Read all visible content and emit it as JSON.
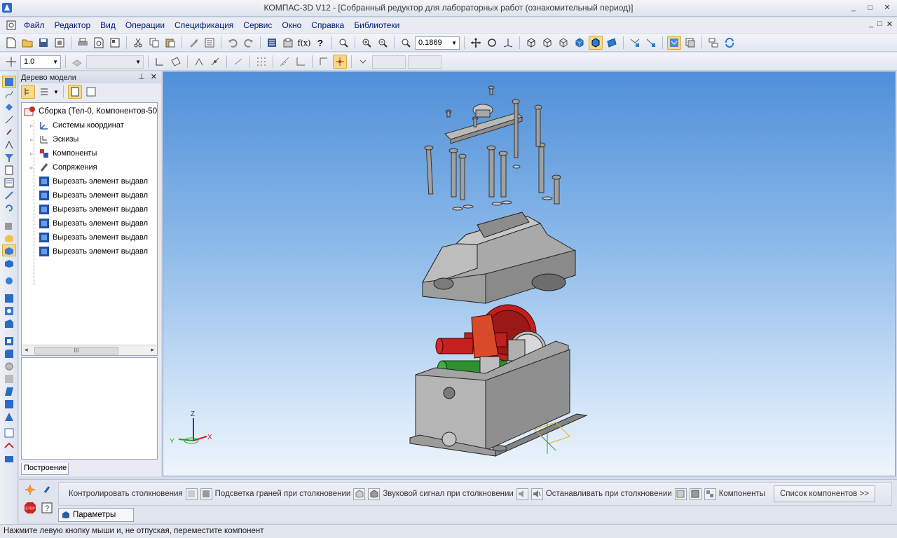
{
  "window": {
    "title": "КОМПАС-3D V12 - [Собранный редуктор для лабораторных работ (ознакомительный период)]",
    "controls": [
      "_",
      "□",
      "✕"
    ]
  },
  "menu": {
    "items": [
      "Файл",
      "Редактор",
      "Вид",
      "Операции",
      "Спецификация",
      "Сервис",
      "Окно",
      "Справка",
      "Библиотеки"
    ],
    "doc_controls": [
      "_",
      "□",
      "✕"
    ]
  },
  "toolbar": {
    "zoom_value": "0.1869",
    "step_value": "1.0"
  },
  "tree": {
    "header": "Дерево модели",
    "root": "Сборка (Тел-0, Компонентов-50",
    "items": [
      {
        "label": "Системы координат",
        "icon": "coordinate-systems-icon"
      },
      {
        "label": "Эскизы",
        "icon": "sketches-icon"
      },
      {
        "label": "Компоненты",
        "icon": "components-icon"
      },
      {
        "label": "Сопряжения",
        "icon": "mates-icon"
      },
      {
        "label": "Вырезать элемент выдавл",
        "icon": "cut-extrude-icon"
      },
      {
        "label": "Вырезать элемент выдавл",
        "icon": "cut-extrude-icon"
      },
      {
        "label": "Вырезать элемент выдавл",
        "icon": "cut-extrude-icon"
      },
      {
        "label": "Вырезать элемент выдавл",
        "icon": "cut-extrude-icon"
      },
      {
        "label": "Вырезать элемент выдавл",
        "icon": "cut-extrude-icon"
      },
      {
        "label": "Вырезать элемент выдавл",
        "icon": "cut-extrude-icon"
      }
    ],
    "scroll_grip": "III",
    "tab": "Построение"
  },
  "viewport": {
    "axes": {
      "x": "X",
      "y": "Y",
      "z": "Z"
    }
  },
  "propbar": {
    "control_collisions": "Контролировать столкновения",
    "highlight_faces": "Подсветка граней при столкновении",
    "sound_signal": "Звуковой сигнал при столкновении",
    "stop_on_collision": "Останавливать при столкновении",
    "components": "Компоненты",
    "list_button": "Список компонентов  >>",
    "tab": "Параметры"
  },
  "status": {
    "text": "Нажмите левую кнопку мыши и, не отпуская, переместите компонент"
  },
  "colors": {
    "accent": "#f7d98a",
    "viewport_top": "#4f8fd8",
    "viewport_bottom": "#eef5fc",
    "housing": "#a9a9a9",
    "gear": "#cc2222",
    "shaft_green": "#2f8f2f"
  }
}
